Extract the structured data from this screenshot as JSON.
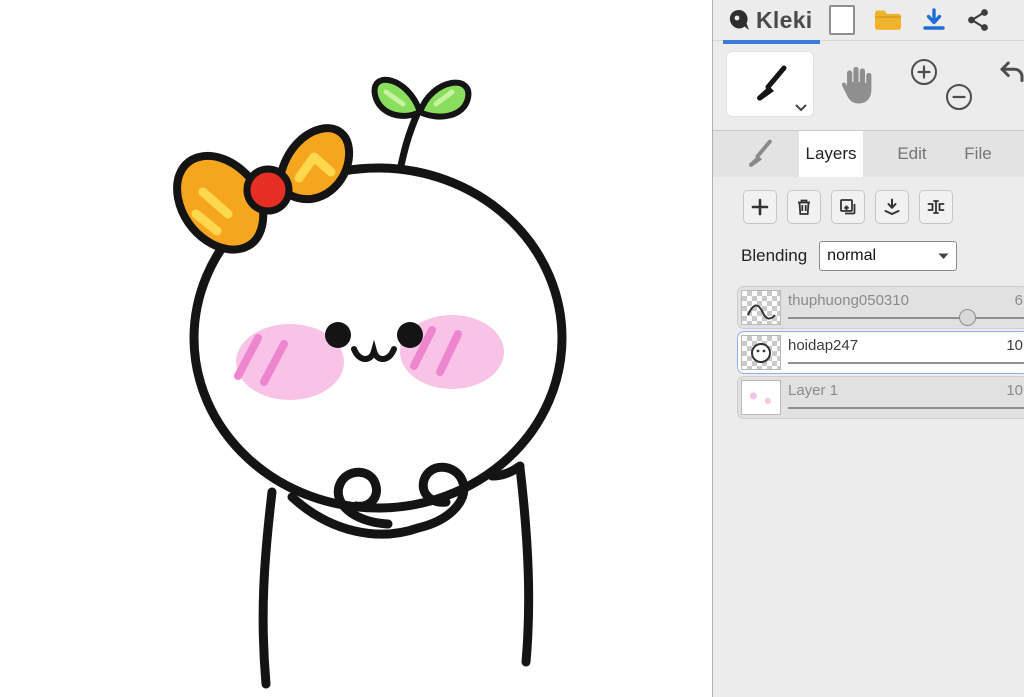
{
  "app": {
    "title": "Kleki"
  },
  "topbar": {
    "icons": [
      "kleki-logo",
      "new-file",
      "open-folder",
      "download",
      "share"
    ]
  },
  "toolbar": {
    "tools": [
      {
        "name": "brush",
        "selected": true
      },
      {
        "name": "hand",
        "selected": false
      }
    ],
    "icons": [
      "zoom-in",
      "zoom-out",
      "undo"
    ]
  },
  "panel_tabs": {
    "tabs": [
      {
        "label": "Layers",
        "selected": true
      },
      {
        "label": "Edit",
        "selected": false
      },
      {
        "label": "File",
        "selected": false
      }
    ]
  },
  "layers_panel": {
    "action_icons": [
      "add-layer",
      "delete-layer",
      "duplicate-layer",
      "merge-layer",
      "rename-layer"
    ],
    "blending_label": "Blending",
    "blending_value": "normal",
    "layers": [
      {
        "name": "thuphuong050310",
        "opacity_display": "6",
        "selected": false
      },
      {
        "name": "hoidap247",
        "opacity_display": "10",
        "selected": true
      },
      {
        "name": "Layer 1",
        "opacity_display": "10",
        "selected": false
      }
    ]
  },
  "colors": {
    "accent_blue": "#3b7bdb",
    "download_blue": "#1d6fd2",
    "folder_yellow": "#f0b32e",
    "bow_orange": "#f6a51f",
    "bow_red": "#e62e24",
    "leaf_green": "#8ade5e",
    "blush_pink": "#f7bce3"
  }
}
